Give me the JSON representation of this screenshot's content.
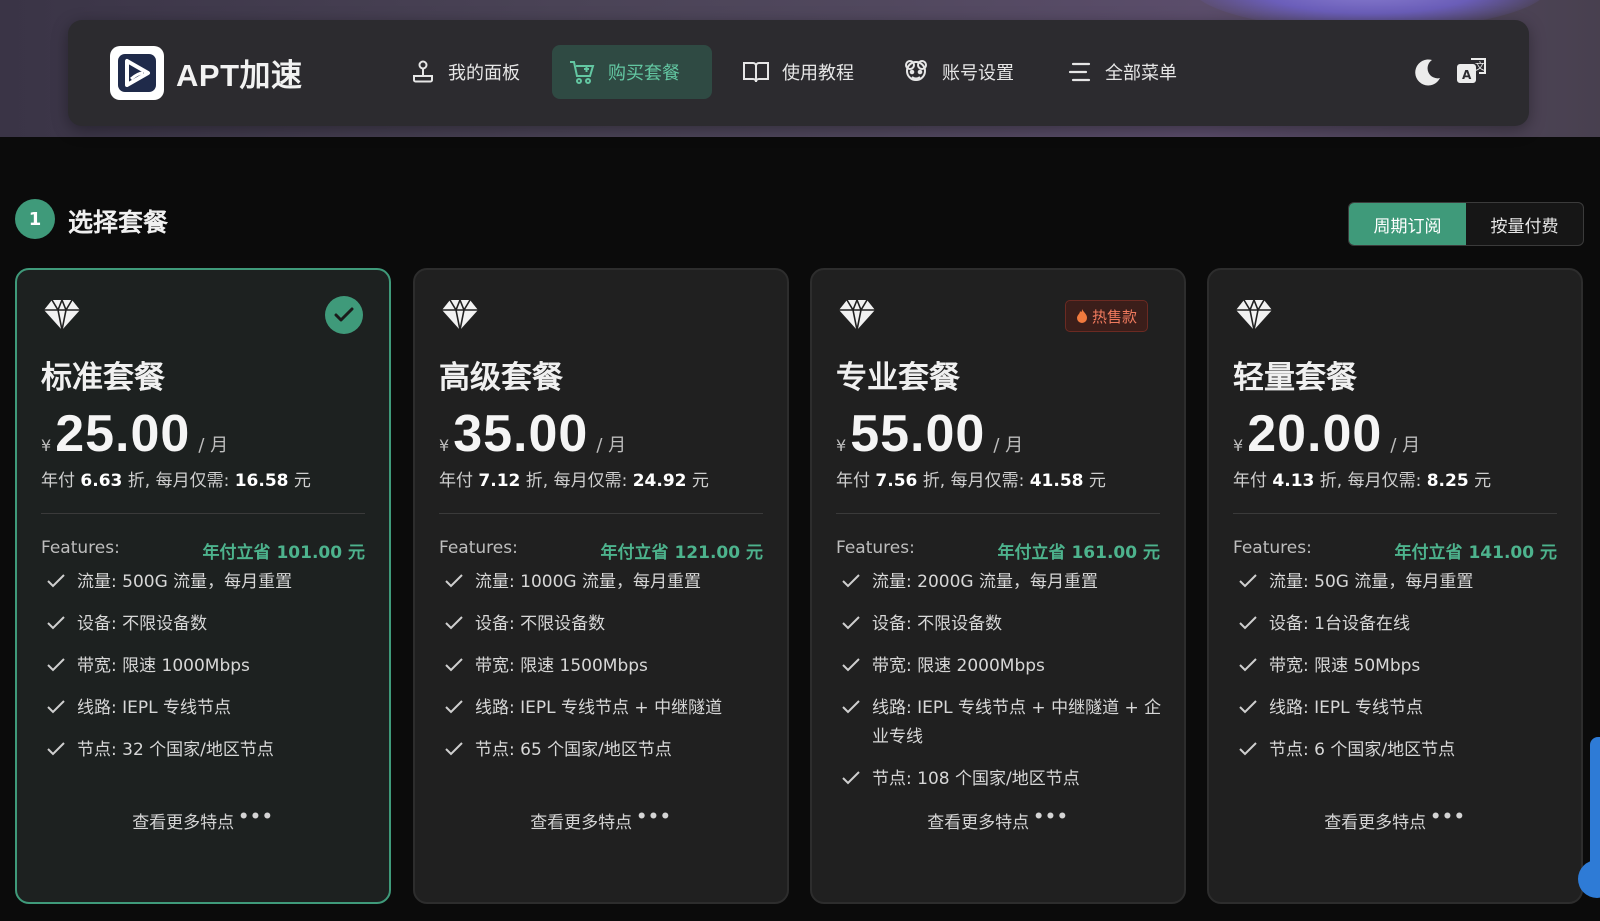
{
  "brand": {
    "name": "APT加速",
    "accent": "#3f9a7a"
  },
  "nav": {
    "items": [
      {
        "label": "我的面板",
        "icon": "joystick-icon"
      },
      {
        "label": "购买套餐",
        "icon": "cart-icon",
        "active": true
      },
      {
        "label": "使用教程",
        "icon": "book-icon"
      },
      {
        "label": "账号设置",
        "icon": "user-settings-icon"
      },
      {
        "label": "全部菜单",
        "icon": "menu-icon"
      }
    ],
    "right_icons": [
      "moon-icon",
      "translate-icon"
    ]
  },
  "section": {
    "step": "1",
    "title": "选择套餐"
  },
  "billing_toggle": {
    "options": [
      "周期订阅",
      "按量付费"
    ],
    "selected": "周期订阅"
  },
  "plans": [
    {
      "name": "标准套餐",
      "currency": "¥",
      "price": "25.00",
      "per": "/ 月",
      "annual_prefix": "年付",
      "annual_discount": "6.63",
      "annual_mid": "折, 每月仅需:",
      "annual_monthly": "16.58",
      "annual_suffix": "元",
      "features_label": "Features:",
      "save_text": "年付立省 101.00 元",
      "features": [
        "流量: 500G 流量，每月重置",
        "设备: 不限设备数",
        "带宽: 限速 1000Mbps",
        "线路: IEPL 专线节点",
        "节点: 32 个国家/地区节点"
      ],
      "more_label": "查看更多特点",
      "more_dots": "•••",
      "selected": true,
      "badge": ""
    },
    {
      "name": "高级套餐",
      "currency": "¥",
      "price": "35.00",
      "per": "/ 月",
      "annual_prefix": "年付",
      "annual_discount": "7.12",
      "annual_mid": "折, 每月仅需:",
      "annual_monthly": "24.92",
      "annual_suffix": "元",
      "features_label": "Features:",
      "save_text": "年付立省 121.00 元",
      "features": [
        "流量: 1000G 流量，每月重置",
        "设备: 不限设备数",
        "带宽: 限速 1500Mbps",
        "线路: IEPL 专线节点 + 中继隧道",
        "节点: 65 个国家/地区节点"
      ],
      "more_label": "查看更多特点",
      "more_dots": "•••",
      "selected": false,
      "badge": ""
    },
    {
      "name": "专业套餐",
      "currency": "¥",
      "price": "55.00",
      "per": "/ 月",
      "annual_prefix": "年付",
      "annual_discount": "7.56",
      "annual_mid": "折, 每月仅需:",
      "annual_monthly": "41.58",
      "annual_suffix": "元",
      "features_label": "Features:",
      "save_text": "年付立省 161.00 元",
      "features": [
        "流量: 2000G 流量，每月重置",
        "设备: 不限设备数",
        "带宽: 限速 2000Mbps",
        "线路: IEPL 专线节点 + 中继隧道 + 企业专线",
        "节点: 108 个国家/地区节点"
      ],
      "more_label": "查看更多特点",
      "more_dots": "•••",
      "selected": false,
      "badge": "热售款"
    },
    {
      "name": "轻量套餐",
      "currency": "¥",
      "price": "20.00",
      "per": "/ 月",
      "annual_prefix": "年付",
      "annual_discount": "4.13",
      "annual_mid": "折, 每月仅需:",
      "annual_monthly": "8.25",
      "annual_suffix": "元",
      "features_label": "Features:",
      "save_text": "年付立省 141.00 元",
      "features": [
        "流量: 50G 流量，每月重置",
        "设备: 1台设备在线",
        "带宽: 限速 50Mbps",
        "线路: IEPL 专线节点",
        "节点: 6 个国家/地区节点"
      ],
      "more_label": "查看更多特点",
      "more_dots": "•••",
      "selected": false,
      "badge": ""
    }
  ]
}
